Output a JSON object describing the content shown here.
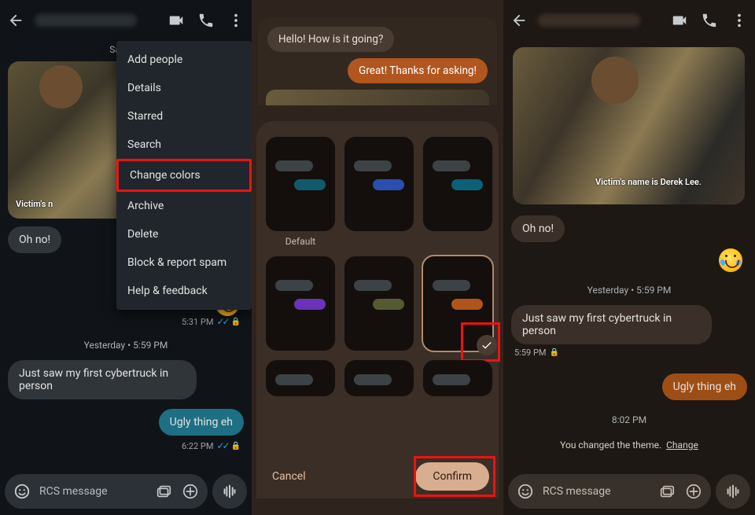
{
  "panel1": {
    "date_label": "Saturda",
    "image_caption": "Victim's n",
    "menu": {
      "items": [
        {
          "label": "Add people"
        },
        {
          "label": "Details"
        },
        {
          "label": "Starred"
        },
        {
          "label": "Search"
        },
        {
          "label": "Change colors",
          "highlighted": true
        },
        {
          "label": "Archive"
        },
        {
          "label": "Delete"
        },
        {
          "label": "Block & report spam"
        },
        {
          "label": "Help & feedback"
        }
      ]
    },
    "msg_oh_no": "Oh no!",
    "time_a": "5:31 PM",
    "date_sep": "Yesterday • 5:59 PM",
    "msg_cybertruck": "Just saw my first cybertruck in person",
    "msg_ugly": "Ugly thing eh",
    "time_b": "6:22 PM",
    "compose_placeholder": "RCS message"
  },
  "panel2": {
    "preview_in": "Hello! How is it going?",
    "preview_out": "Great! Thanks for asking!",
    "swatches": [
      {
        "label": "Default",
        "accent": "teal"
      },
      {
        "label": "",
        "accent": "blue"
      },
      {
        "label": "",
        "accent": "cyan"
      },
      {
        "label": "",
        "accent": "purple"
      },
      {
        "label": "",
        "accent": "olive"
      },
      {
        "label": "",
        "accent": "orange",
        "selected": true
      },
      {
        "label": "",
        "accent": "none"
      },
      {
        "label": "",
        "accent": "none"
      },
      {
        "label": "",
        "accent": "none"
      }
    ],
    "cancel": "Cancel",
    "confirm": "Confirm"
  },
  "panel3": {
    "image_caption": "Victim's name is Derek Lee.",
    "msg_oh_no": "Oh no!",
    "date_sep": "Yesterday • 5:59 PM",
    "msg_cybertruck": "Just saw my first cybertruck in person",
    "time_a": "5:59 PM",
    "msg_ugly": "Ugly thing eh",
    "time_b": "8:02 PM",
    "system_msg": "You changed the theme.",
    "system_link": "Change",
    "compose_placeholder": "RCS message"
  },
  "icons": {
    "back": "arrow-back-icon",
    "video": "video-call-icon",
    "phone": "phone-call-icon",
    "more": "more-vert-icon",
    "smiley": "emoji-icon",
    "gallery": "gallery-icon",
    "plus": "plus-icon",
    "voice": "audio-wave-icon",
    "check": "check-icon",
    "lock": "lock-icon"
  }
}
